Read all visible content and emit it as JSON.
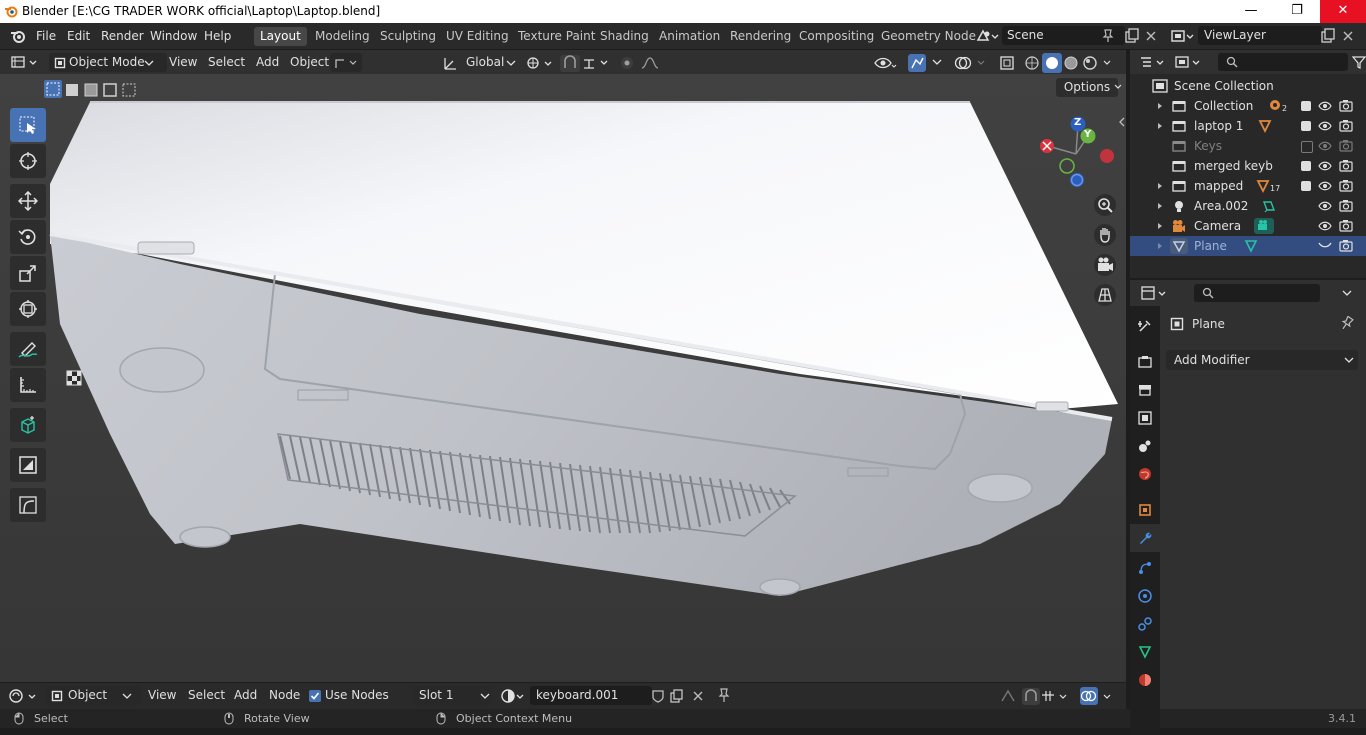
{
  "window": {
    "title": "Blender [E:\\CG TRADER WORK official\\Laptop\\Laptop.blend]",
    "minimize": "—",
    "maximize": "❐",
    "close": "✕"
  },
  "menu": {
    "items": [
      "File",
      "Edit",
      "Render",
      "Window",
      "Help"
    ]
  },
  "workspaces": {
    "tabs": [
      "Layout",
      "Modeling",
      "Sculpting",
      "UV Editing",
      "Texture Paint",
      "Shading",
      "Animation",
      "Rendering",
      "Compositing",
      "Geometry Node"
    ],
    "active": "Layout"
  },
  "scene": {
    "name": "Scene"
  },
  "viewlayer": {
    "name": "ViewLayer"
  },
  "viewport_header": {
    "mode": "Object Mode",
    "menus": [
      "View",
      "Select",
      "Add",
      "Object"
    ],
    "orientation": "Global",
    "options": "Options"
  },
  "gizmo": {
    "z": "Z",
    "y": "Y"
  },
  "outliner": {
    "root": "Scene Collection",
    "rows": [
      {
        "label": "Collection",
        "badge": "2",
        "checked": true
      },
      {
        "label": "laptop 1",
        "badge": "",
        "checked": true
      },
      {
        "label": "Keys",
        "badge": "",
        "checked": false
      },
      {
        "label": "merged keyb",
        "badge": "",
        "checked": true
      },
      {
        "label": "mapped",
        "badge": "17",
        "checked": true
      },
      {
        "label": "Area.002",
        "badge": "",
        "checked": null
      },
      {
        "label": "Camera",
        "badge": "",
        "checked": null
      },
      {
        "label": "Plane",
        "badge": "",
        "checked": null
      }
    ]
  },
  "properties": {
    "object": "Plane",
    "add_modifier": "Add Modifier"
  },
  "shader_header": {
    "type": "Object",
    "menus": [
      "View",
      "Select",
      "Add",
      "Node"
    ],
    "use_nodes": "Use Nodes",
    "slot": "Slot 1",
    "material": "keyboard.001"
  },
  "status": {
    "select": "Select",
    "rotate": "Rotate View",
    "context": "Object Context Menu",
    "version": "3.4.1"
  },
  "colors": {
    "accent": "#4772b3",
    "selection": "#334d80",
    "close_red": "#e81123",
    "orange": "#e0883c"
  }
}
